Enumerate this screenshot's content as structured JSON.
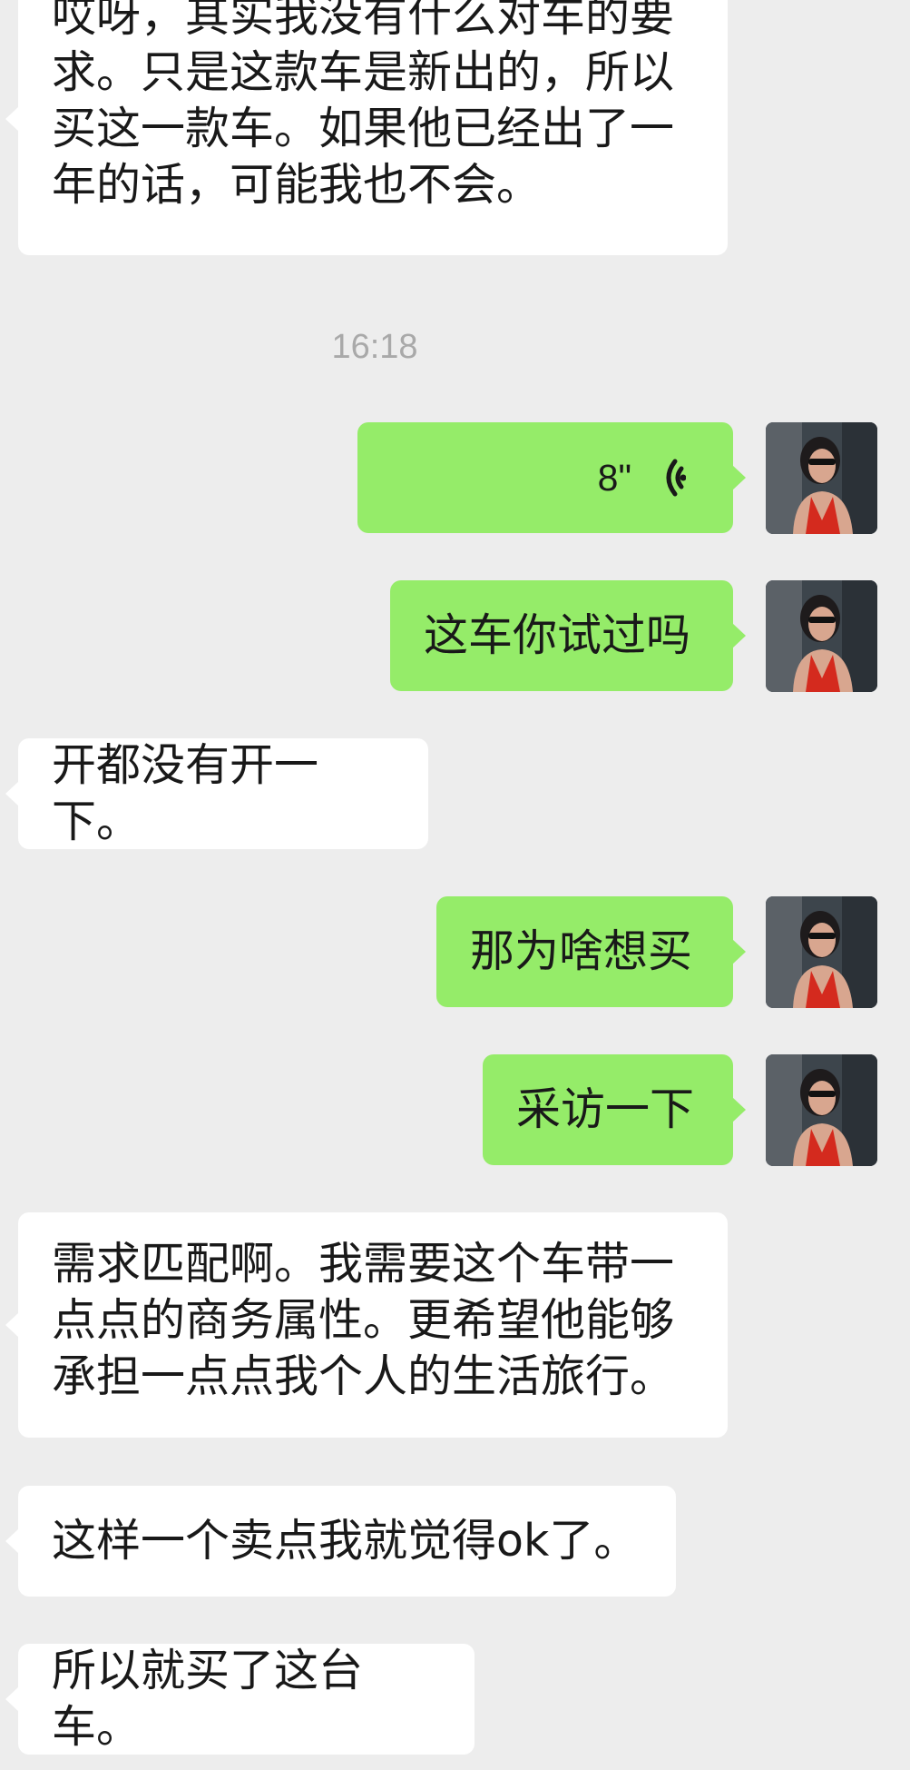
{
  "messages": [
    {
      "side": "received",
      "text": "哎呀，其实我没有什么对车的要求。只是这款车是新出的，所以买这一款车。如果他已经出了一年的话，可能我也不会。"
    },
    {
      "timestamp": "16:18"
    },
    {
      "side": "sent",
      "type": "voice",
      "duration": "8\""
    },
    {
      "side": "sent",
      "text": "这车你试过吗"
    },
    {
      "side": "received",
      "text": "开都没有开一下。"
    },
    {
      "side": "sent",
      "text": "那为啥想买"
    },
    {
      "side": "sent",
      "text": "采访一下"
    },
    {
      "side": "received",
      "text": "需求匹配啊。我需要这个车带一点点的商务属性。更希望他能够承担一点点我个人的生活旅行。"
    },
    {
      "side": "received",
      "text": "这样一个卖点我就觉得ok了。"
    },
    {
      "side": "received",
      "text": "所以就买了这台车。"
    }
  ],
  "colors": {
    "background": "#ededed",
    "sent_bubble": "#95ec69",
    "received_bubble": "#ffffff",
    "timestamp": "#a9a9a9"
  },
  "icons": {
    "voice": "voice-wave-icon",
    "avatar": "user-avatar"
  }
}
